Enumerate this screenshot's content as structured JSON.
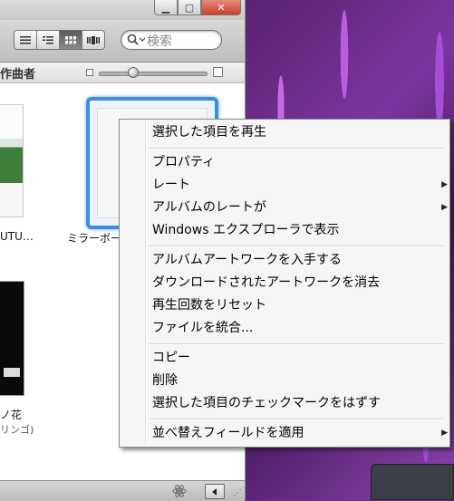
{
  "window": {
    "controls": {
      "minimize": "▁",
      "maximize": "▢",
      "close": "✕"
    }
  },
  "toolbar": {
    "view_buttons": [
      "list-view",
      "album-list-view",
      "grid-view",
      "coverflow-view"
    ],
    "active_view": "grid-view",
    "search_placeholder": "検索"
  },
  "header": {
    "column_label": "作曲者",
    "zoom_level": 0.3
  },
  "albums": [
    {
      "title": "UTU…"
    },
    {
      "title": "ミラーボー"
    },
    {
      "title": "ノ花",
      "artist": "リンゴ)"
    }
  ],
  "context_menu": {
    "groups": [
      [
        {
          "label": "選択した項目を再生"
        }
      ],
      [
        {
          "label": "プロパティ"
        },
        {
          "label": "レート",
          "submenu": true
        },
        {
          "label": "アルバムのレートが",
          "submenu": true
        },
        {
          "label": "Windows エクスプローラで表示"
        }
      ],
      [
        {
          "label": "アルバムアートワークを入手する"
        },
        {
          "label": "ダウンロードされたアートワークを消去"
        },
        {
          "label": "再生回数をリセット"
        },
        {
          "label": "ファイルを統合..."
        }
      ],
      [
        {
          "label": "コピー"
        },
        {
          "label": "削除"
        },
        {
          "label": "選択した項目のチェックマークをはずす"
        }
      ],
      [
        {
          "label": "並べ替えフィールドを適用",
          "submenu": true
        }
      ]
    ],
    "submenu_arrow": "▶"
  },
  "colors": {
    "selection_border": "#3b8fe2",
    "close_button": "#c7402c",
    "wallpaper": "#7a35a0"
  }
}
